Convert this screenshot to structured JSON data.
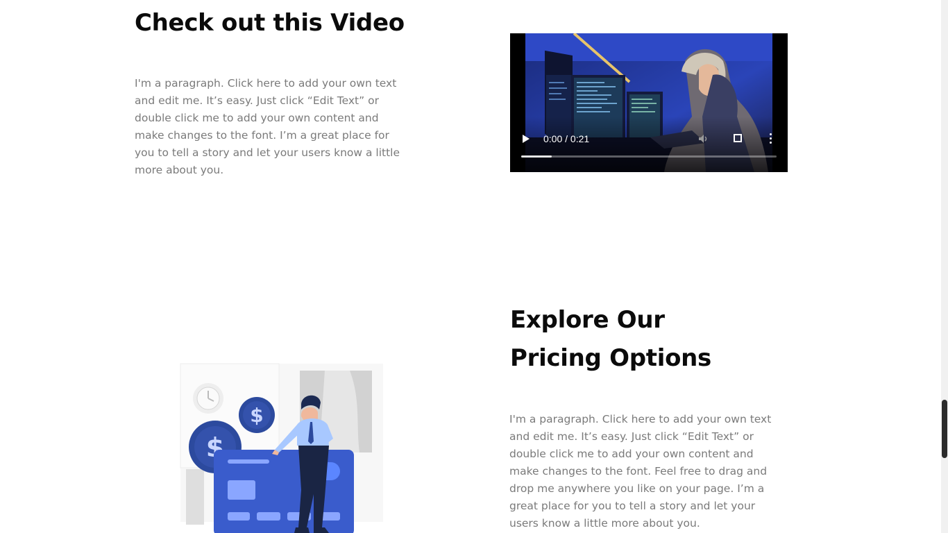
{
  "video_section": {
    "title": "Check out this Video",
    "paragraph": "I'm a paragraph. Click here to add your own text and edit me. It’s easy. Just click “Edit Text” or double click me to add your own content and make changes to the font. I’m a great place for you to tell a story and let your users know a little more about you.",
    "video": {
      "time": "0:00 / 0:21",
      "progress_fraction": 0.12,
      "play_icon": "play-icon",
      "mute_icon": "volume-icon",
      "fullscreen_icon": "fullscreen-icon",
      "more_icon": "more-vertical-icon"
    }
  },
  "pricing_section": {
    "title_line1": "Explore Our",
    "title_line2": "Pricing Options",
    "paragraph": "I'm a paragraph. Click here to add your own text and edit me. It’s easy. Just click “Edit Text” or double click me to add your own content and make changes to the font. Feel free to drag and drop me anywhere you like on your page. I’m a great place for you to tell a story and let your users know a little more about you."
  },
  "colors": {
    "heading": "#0b0b0b",
    "body_text": "#7a7a7a",
    "illustration_blue": "#3a5ccc",
    "coin_blue": "#2c4a9e"
  }
}
